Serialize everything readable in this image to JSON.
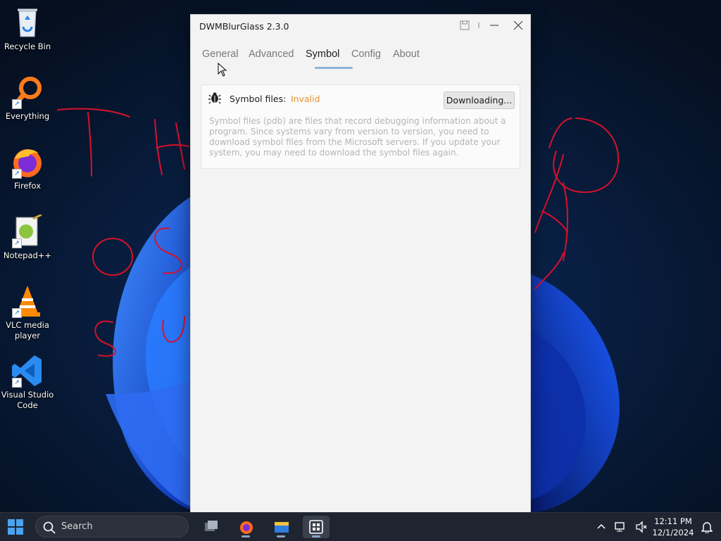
{
  "desktop": {
    "icons": [
      {
        "label": "Recycle Bin",
        "icon": "recycle-bin-icon",
        "shortcut": false
      },
      {
        "label": "Everything",
        "icon": "everything-search-icon",
        "shortcut": true
      },
      {
        "label": "Firefox",
        "icon": "firefox-icon",
        "shortcut": true
      },
      {
        "label": "Notepad++",
        "icon": "notepad-plus-plus-icon",
        "shortcut": true
      },
      {
        "label": "VLC media player",
        "icon": "vlc-icon",
        "shortcut": true
      },
      {
        "label": "Visual Studio Code",
        "icon": "vscode-icon",
        "shortcut": true
      }
    ]
  },
  "window": {
    "title": "DWMBlurGlass 2.3.0",
    "tabs": [
      {
        "label": "General",
        "active": false
      },
      {
        "label": "Advanced",
        "active": false
      },
      {
        "label": "Symbol",
        "active": true
      },
      {
        "label": "Config",
        "active": false
      },
      {
        "label": "About",
        "active": false
      }
    ],
    "symbol_card": {
      "label": "Symbol files:",
      "status": "Invalid",
      "status_color": "#e8912f",
      "button": "Downloading...",
      "description": "Symbol files (pdb) are files that record debugging information about a program. Since systems vary from version to version, you need to download symbol files from the Microsoft servers. If you update your system, you may need to download the symbol files again."
    }
  },
  "taskbar": {
    "search_label": "Search",
    "time": "12:11 PM",
    "date": "12/1/2024"
  },
  "colors": {
    "accent_underline": "#8fb4d9",
    "annotation_red": "#d8112c"
  }
}
